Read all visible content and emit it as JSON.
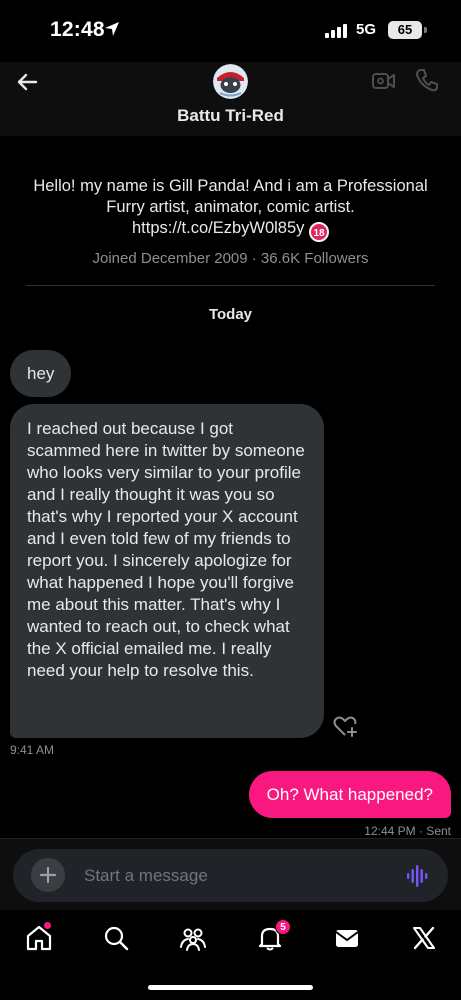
{
  "status_bar": {
    "time": "12:48",
    "network": "5G",
    "battery": "65"
  },
  "header": {
    "name": "Battu Tri-Red"
  },
  "profile": {
    "bio": "Hello! my name is Gill Panda! And i am a Professional Furry artist, animator, comic artist. https://t.co/EzbyW0l85y",
    "adult_badge": "18",
    "meta": "Joined December 2009 · 36.6K Followers"
  },
  "conversation": {
    "day_label": "Today",
    "messages": [
      {
        "direction": "in",
        "text": "hey"
      },
      {
        "direction": "in",
        "text": "I reached out because I got scammed here in twitter by someone who looks very similar to your profile and I really thought it was you so that's why I reported your X account and I even told few of my friends to report you. I sincerely apologize for what happened I hope you'll forgive me about this matter. That's why I wanted to reach out, to check what the X official emailed me. I really need your help to resolve this.",
        "time": "9:41 AM"
      },
      {
        "direction": "out",
        "text": "Oh? What happened?",
        "time": "12:44 PM · Sent"
      }
    ]
  },
  "composer": {
    "placeholder": "Start a message"
  },
  "tab_bar": {
    "items": [
      "home-icon",
      "search-icon",
      "communities-icon",
      "notifications-icon",
      "messages-icon",
      "x-logo-icon"
    ],
    "notifications_count": "5"
  },
  "colors": {
    "accent": "#f91880",
    "incoming_bubble": "#2f3336",
    "voice_icon": "#7856ff"
  }
}
